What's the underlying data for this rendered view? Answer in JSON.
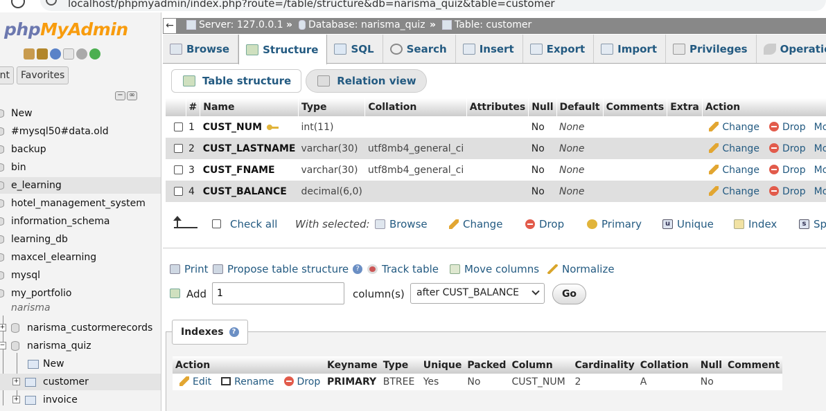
{
  "browser": {
    "url": "localhost/phpmyadmin/index.php?route=/table/structure&db=narisma_quiz&table=customer"
  },
  "nav": {
    "logo_php": "php",
    "logo_myadmin": "MyAdmin",
    "tabs": [
      "Recent",
      "Favorites"
    ],
    "tree": [
      {
        "label": "New"
      },
      {
        "label": "#mysql50#data.old"
      },
      {
        "label": "backup"
      },
      {
        "label": "bin"
      },
      {
        "label": "e_learning"
      },
      {
        "label": "hotel_management_system"
      },
      {
        "label": "information_schema"
      },
      {
        "label": "learning_db"
      },
      {
        "label": "maxcel_elearning"
      },
      {
        "label": "mysql"
      },
      {
        "label": "my_portfolio"
      }
    ],
    "group": "narisma",
    "subdbs": [
      "narisma_custormerecords",
      "narisma_quiz"
    ],
    "tables": [
      "New",
      "customer",
      "invoice"
    ]
  },
  "breadcrumb": {
    "server": "Server: 127.0.0.1",
    "database": "Database: narisma_quiz",
    "table": "Table: customer"
  },
  "tabs": [
    "Browse",
    "Structure",
    "SQL",
    "Search",
    "Insert",
    "Export",
    "Import",
    "Privileges",
    "Operations"
  ],
  "subtabs": [
    "Table structure",
    "Relation view"
  ],
  "structure": {
    "headers": [
      "#",
      "Name",
      "Type",
      "Collation",
      "Attributes",
      "Null",
      "Default",
      "Comments",
      "Extra",
      "Action"
    ],
    "rows": [
      {
        "num": "1",
        "name": "CUST_NUM",
        "type": "int(11)",
        "collation": "",
        "null": "No",
        "default": "None"
      },
      {
        "num": "2",
        "name": "CUST_LASTNAME",
        "type": "varchar(30)",
        "collation": "utf8mb4_general_ci",
        "null": "No",
        "default": "None"
      },
      {
        "num": "3",
        "name": "CUST_FNAME",
        "type": "varchar(30)",
        "collation": "utf8mb4_general_ci",
        "null": "No",
        "default": "None"
      },
      {
        "num": "4",
        "name": "CUST_BALANCE",
        "type": "decimal(6,0)",
        "collation": "",
        "null": "No",
        "default": "None"
      }
    ],
    "row_actions": {
      "change": "Change",
      "drop": "Drop",
      "more": "More"
    }
  },
  "with_selected": {
    "check_all": "Check all",
    "label": "With selected:",
    "items": [
      "Browse",
      "Change",
      "Drop",
      "Primary",
      "Unique",
      "Index",
      "Spatial"
    ]
  },
  "tools": {
    "print": "Print",
    "propose": "Propose table structure",
    "track": "Track table",
    "move": "Move columns",
    "normalize": "Normalize"
  },
  "add_columns": {
    "label": "Add",
    "count": "1",
    "unit": "column(s)",
    "position": "after CUST_BALANCE",
    "go": "Go"
  },
  "indexes": {
    "title": "Indexes",
    "headers": [
      "Action",
      "Keyname",
      "Type",
      "Unique",
      "Packed",
      "Column",
      "Cardinality",
      "Collation",
      "Null",
      "Comment"
    ],
    "row": {
      "edit": "Edit",
      "rename": "Rename",
      "drop": "Drop",
      "keyname": "PRIMARY",
      "type": "BTREE",
      "unique": "Yes",
      "packed": "No",
      "column": "CUST_NUM",
      "cardinality": "2",
      "collation": "A",
      "null": "No",
      "comment": ""
    }
  },
  "colors": {
    "link": "#235a81",
    "breadcrumb_bg": "#888888",
    "logo_blue": "#6c78af",
    "logo_orange": "#f89c0e"
  }
}
